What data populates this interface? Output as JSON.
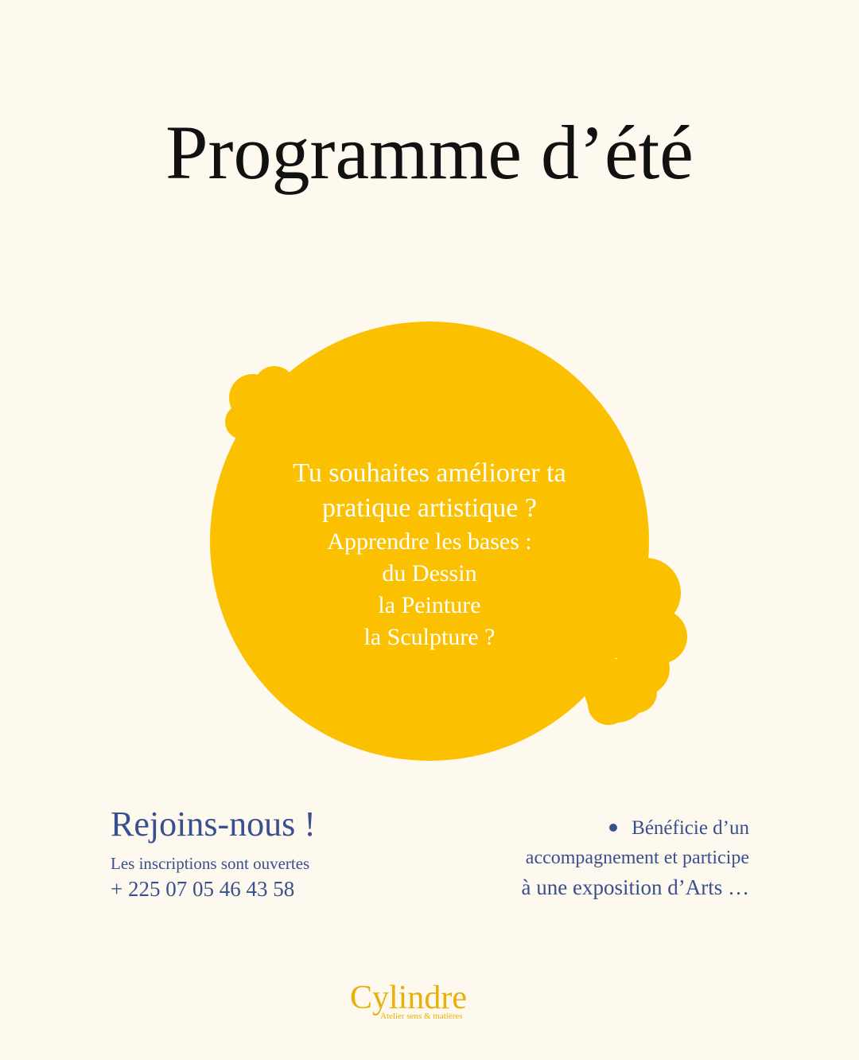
{
  "title": "Programme d’été",
  "blob": {
    "color": "#fbc100",
    "lines_big": [
      "Tu souhaites améliorer ta",
      "pratique artistique ?"
    ],
    "lines_small": [
      "Apprendre les bases  :",
      "du Dessin",
      "la Peinture",
      "la Sculpture ?"
    ]
  },
  "join": {
    "heading": "Rejoins-nous !",
    "subtitle": "Les inscriptions sont ouvertes",
    "phone": "+ 225 07 05 46 43 58"
  },
  "benefit": {
    "line1": "Bénéficie d’un",
    "line2": "accompagnement et participe",
    "line3": "à une exposition d’Arts …"
  },
  "logo": {
    "name": "Cylindre",
    "tagline": "Atelier sens & matières"
  },
  "colors": {
    "background": "#fdf9ee",
    "accent_yellow": "#fbc100",
    "text_blue": "#3a4f8f",
    "logo_gold": "#e8b10a"
  }
}
